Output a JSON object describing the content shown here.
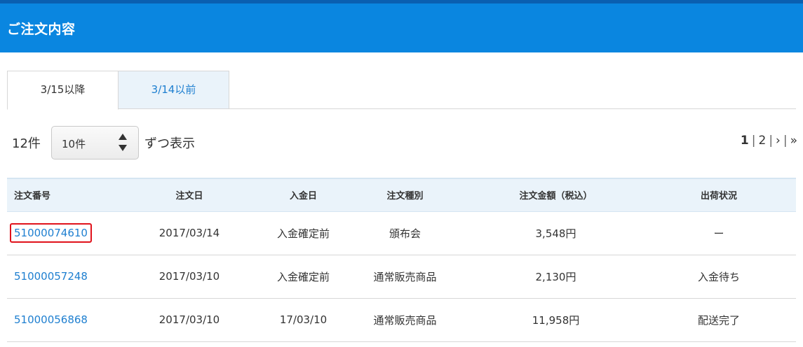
{
  "header": {
    "title": "ご注文内容"
  },
  "tabs": [
    {
      "label": "3/15以降",
      "active": true
    },
    {
      "label": "3/14以前",
      "active": false
    }
  ],
  "controls": {
    "total_count": "12件",
    "per_page_value": "10件",
    "per_page_suffix": "ずつ表示"
  },
  "pager": {
    "current": "1",
    "page2": "2",
    "next": "›",
    "last": "»",
    "separator": "|"
  },
  "table": {
    "headers": {
      "order_no": "注文番号",
      "order_date": "注文日",
      "payment_date": "入金日",
      "order_type": "注文種別",
      "amount": "注文金額（税込）",
      "shipping_status": "出荷状況"
    },
    "rows": [
      {
        "order_no": "51000074610",
        "order_date": "2017/03/14",
        "payment_date": "入金確定前",
        "order_type": "頒布会",
        "amount": "3,548円",
        "shipping_status": "ー"
      },
      {
        "order_no": "51000057248",
        "order_date": "2017/03/10",
        "payment_date": "入金確定前",
        "order_type": "通常販売商品",
        "amount": "2,130円",
        "shipping_status": "入金待ち"
      },
      {
        "order_no": "51000056868",
        "order_date": "2017/03/10",
        "payment_date": "17/03/10",
        "order_type": "通常販売商品",
        "amount": "11,958円",
        "shipping_status": "配送完了"
      }
    ]
  },
  "colors": {
    "header_bg": "#0a86e0",
    "link": "#1e7fd0",
    "highlight_border": "#e0121b",
    "table_header_bg": "#eaf3fa"
  }
}
